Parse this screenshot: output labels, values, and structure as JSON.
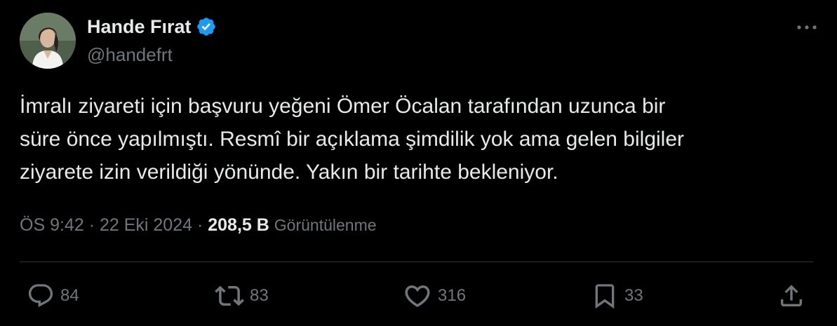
{
  "author": {
    "display_name": "Hande Fırat",
    "handle": "@handefrt",
    "verified_icon": "verified-badge-icon",
    "avatar_icon": "profile-photo"
  },
  "tweet": {
    "text": "İmralı ziyareti için başvuru yeğeni Ömer Öcalan tarafından uzunca bir\nsüre önce yapılmıştı. Resmî bir açıklama şimdilik yok ama gelen bilgiler\nziyarete izin verildiği yönünde. Yakın bir tarihte bekleniyor.",
    "time": "ÖS 9:42",
    "separator": "·",
    "date": "22 Eki 2024",
    "views_count": "208,5 B",
    "views_label": "Görüntülenme"
  },
  "actions": {
    "replies": "84",
    "retweets": "83",
    "likes": "316",
    "bookmarks": "33"
  },
  "colors": {
    "background": "#000000",
    "text_primary": "#e7e9ea",
    "text_secondary": "#71767b",
    "verified": "#1d9bf0",
    "divider": "#2f3336"
  }
}
